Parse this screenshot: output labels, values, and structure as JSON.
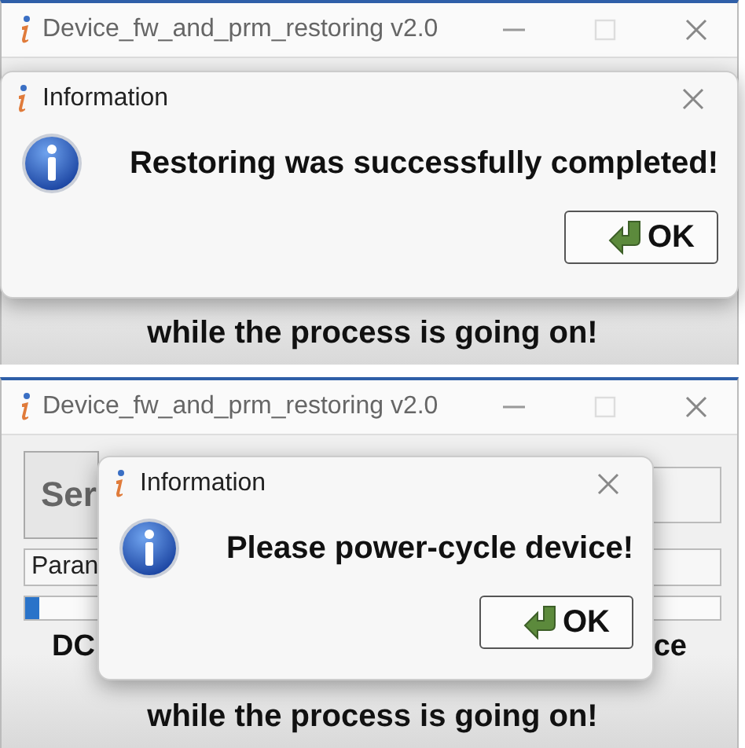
{
  "panels": [
    {
      "window": {
        "title": "Device_fw_and_prm_restoring v2.0"
      },
      "behind": {
        "kind": "plain",
        "footer": "while the process is going on!"
      },
      "dialog": {
        "title": "Information",
        "message": "Restoring was successfully completed!",
        "button": "OK",
        "kind": "wide"
      }
    },
    {
      "window": {
        "title": "Device_fw_and_prm_restoring v2.0"
      },
      "behind": {
        "kind": "form",
        "button": "Ser",
        "field": "Paran",
        "progress": {
          "level": 0.02
        },
        "warning_left": "DC",
        "warning_right": "ce",
        "footer": "while the process is going on!"
      },
      "dialog": {
        "title": "Information",
        "message": "Please power-cycle device!",
        "button": "OK",
        "kind": "centered"
      }
    }
  ]
}
